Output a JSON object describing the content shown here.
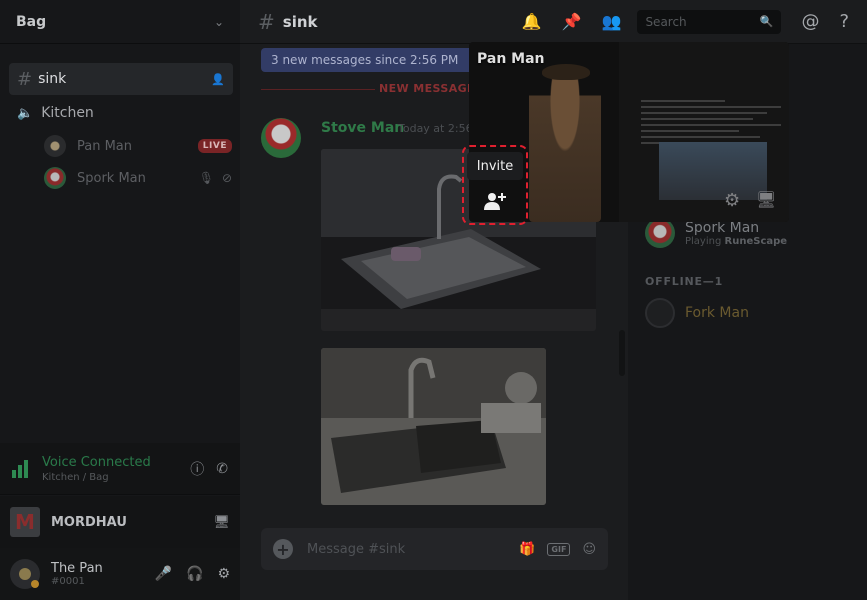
{
  "sidebar": {
    "server_name": "Bag",
    "text_channel": "sink",
    "voice_channel": "Kitchen",
    "voice_users": [
      {
        "name": "Pan Man",
        "badge": "LIVE"
      },
      {
        "name": "Spork Man",
        "badge": ""
      }
    ]
  },
  "voice_panel": {
    "status": "Voice Connected",
    "location": "Kitchen / Bag"
  },
  "game_panel": {
    "name": "MORDHAU",
    "logo_letter": "M"
  },
  "user_panel": {
    "username": "The Pan",
    "tag": "#0001"
  },
  "topbar": {
    "channel": "sink",
    "search_placeholder": "Search"
  },
  "chat": {
    "new_messages_bar": "3 new messages since 2:56 PM",
    "divider_label": "NEW MESSAGES",
    "message": {
      "author": "Stove Man",
      "timestamp": "Today at 2:56"
    },
    "composer_placeholder": "Message #sink",
    "gif_label": "GIF"
  },
  "members": {
    "online_member": {
      "name": "Spork Man",
      "activity_prefix": "Playing",
      "activity_game": "RuneScape"
    },
    "offline_header": "OFFLINE—1",
    "offline_member": {
      "name": "Fork Man"
    }
  },
  "stream": {
    "streamer": "Pan Man"
  },
  "tooltip": {
    "label": "Invite"
  },
  "colors": {
    "accent_green": "#2f7a48",
    "live_red": "#7a2426",
    "highlight": "#e0202f",
    "new_bar": "#323c66"
  }
}
